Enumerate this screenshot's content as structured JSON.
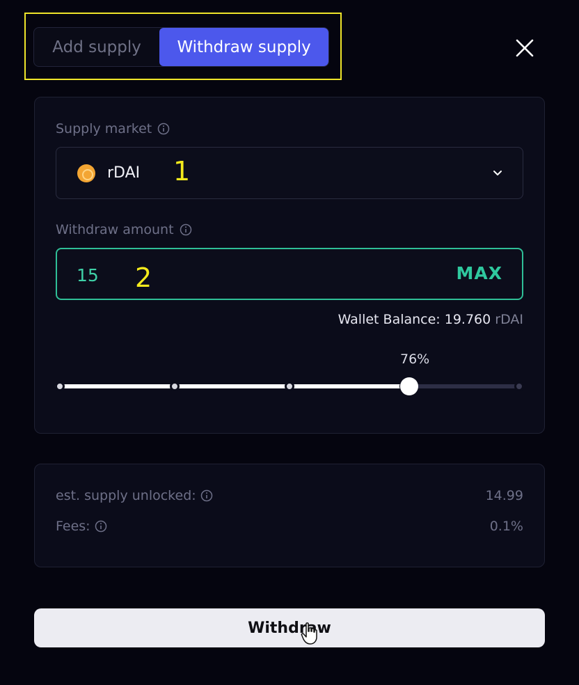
{
  "tabs": {
    "add_label": "Add supply",
    "withdraw_label": "Withdraw supply",
    "active": "withdraw"
  },
  "supply_market": {
    "label": "Supply market",
    "selected_token": "rDAI",
    "token_icon": "rdai-token-icon"
  },
  "withdraw_amount": {
    "label": "Withdraw amount",
    "value": "15",
    "max_label": "MAX"
  },
  "wallet": {
    "prefix": "Wallet Balance: ",
    "amount": "19.760",
    "unit": "rDAI"
  },
  "slider": {
    "percent_label": "76%",
    "percent_value": 76,
    "steps": [
      0,
      25,
      50,
      75,
      100
    ]
  },
  "summary": {
    "unlocked_label": "est. supply unlocked:",
    "unlocked_value": "14.99",
    "fees_label": "Fees:",
    "fees_value": "0.1%"
  },
  "action": {
    "withdraw_label": "Withdraw"
  },
  "annotations": {
    "one": "1",
    "two": "2"
  },
  "colors": {
    "accent": "#4c58ec",
    "success": "#2fc89e",
    "highlight": "#f0e62a"
  }
}
